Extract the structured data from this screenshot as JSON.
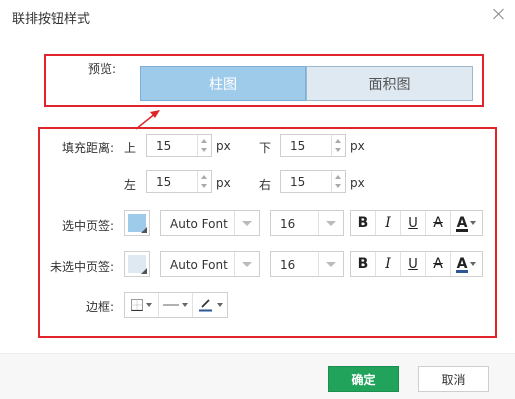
{
  "dialog": {
    "title": "联排按钮样式"
  },
  "preview": {
    "label": "预览:",
    "selected_tab": "柱图",
    "unselected_tab": "面积图"
  },
  "padding": {
    "label": "填充距离:",
    "top": {
      "label": "上",
      "value": "15",
      "unit": "px"
    },
    "bottom": {
      "label": "下",
      "value": "15",
      "unit": "px"
    },
    "left": {
      "label": "左",
      "value": "15",
      "unit": "px"
    },
    "right": {
      "label": "右",
      "value": "15",
      "unit": "px"
    }
  },
  "selected_page": {
    "label": "选中页签:",
    "color": "#9fcbeb",
    "font": "Auto Font",
    "size": "16",
    "font_color": "#222222"
  },
  "unselected_page": {
    "label": "未选中页签:",
    "color": "#dfe9f1",
    "font": "Auto Font",
    "size": "16",
    "font_color": "#2b5797"
  },
  "border": {
    "label": "边框:"
  },
  "format": {
    "bold": "B",
    "italic": "I",
    "underline": "U",
    "strike": "A",
    "font_color": "A"
  },
  "footer": {
    "ok": "确定",
    "cancel": "取消"
  }
}
